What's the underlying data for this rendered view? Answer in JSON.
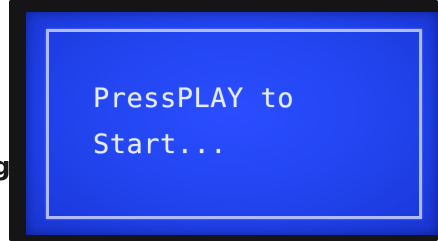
{
  "display": {
    "line1": "PressPLAY to",
    "line2": "Start...",
    "side_text": "g"
  },
  "colors": {
    "screen_blue": "#2346f2",
    "text": "#e6ecff",
    "frame": "#c8d2ff",
    "bezel": "#151518"
  }
}
